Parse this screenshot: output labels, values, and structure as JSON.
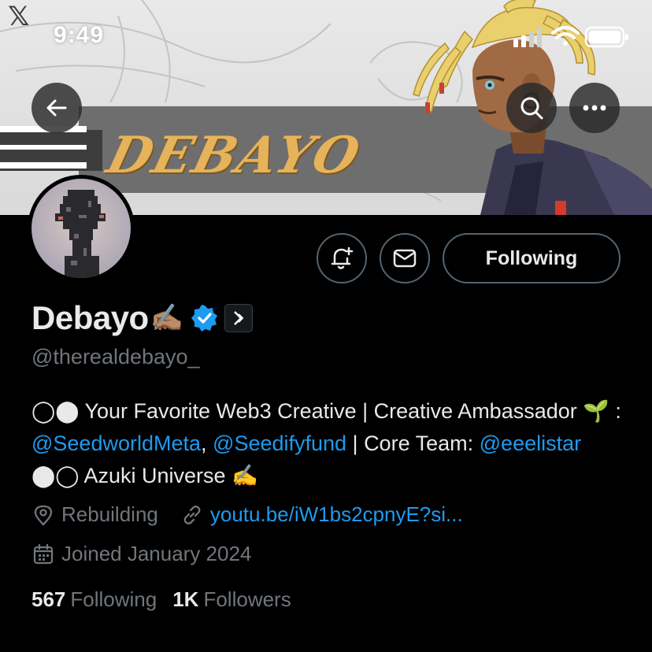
{
  "status_bar": {
    "time": "9:49",
    "app_logo": "𝕏"
  },
  "banner": {
    "title": "DEBAYO"
  },
  "nav": {
    "back_icon": "arrow-left-icon",
    "search_icon": "search-icon",
    "more_icon": "more-horizontal-icon"
  },
  "actions": {
    "notify_icon": "bell-plus-icon",
    "message_icon": "envelope-icon",
    "following_label": "Following"
  },
  "profile": {
    "display_name": "Debayo",
    "name_emoji": "✍🏽",
    "verified": true,
    "handle": "@therealdebayo_",
    "bio": {
      "p1": "◯⬤ Your Favorite Web3 Creative | Creative Ambassador 🌱 : ",
      "m1": "@SeedworldMeta",
      "p2": ", ",
      "m2": "@Seedifyfund",
      "p3": " | Core Team: ",
      "m3": "@eeelistar",
      "p4": " ⬤◯ Azuki Universe ✍️"
    },
    "location": "Rebuilding",
    "link": "youtu.be/iW1bs2cpnyE?si...",
    "joined": "Joined January 2024"
  },
  "stats": {
    "following_count": "567",
    "following_label": "Following",
    "followers_count": "1K",
    "followers_label": "Followers"
  },
  "colors": {
    "accent": "#1d9bf0",
    "muted": "#71767b",
    "border": "#536471",
    "banner_title": "#e6b35a"
  }
}
